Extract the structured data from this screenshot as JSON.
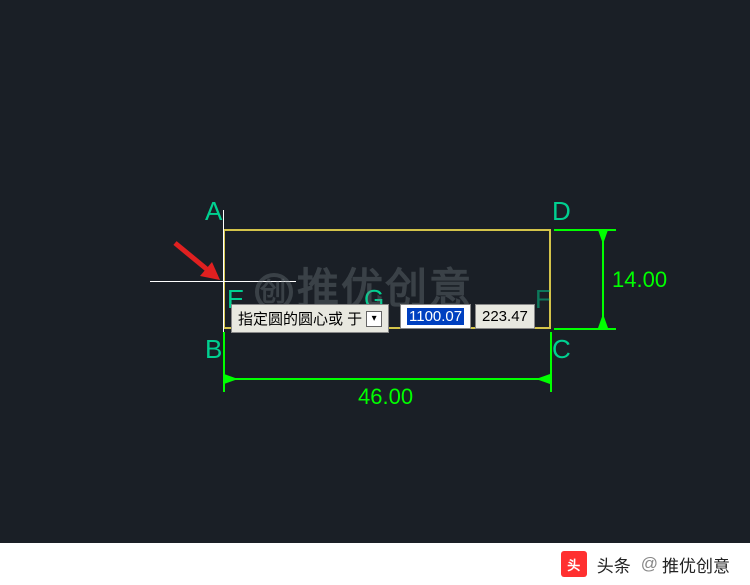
{
  "labels": {
    "A": "A",
    "B": "B",
    "C": "C",
    "D": "D",
    "E": "E",
    "G": "G",
    "F": "F"
  },
  "dimensions": {
    "width": "46.00",
    "height": "14.00"
  },
  "tooltip": {
    "prompt": "指定圆的圆心或 于"
  },
  "dynamic_input": {
    "coord": "1100.07",
    "angle": "223.47"
  },
  "watermark": {
    "text": "推优创意",
    "symbol": "创"
  },
  "footer": {
    "brand": "头条",
    "at": "@",
    "author": "推优创意"
  }
}
